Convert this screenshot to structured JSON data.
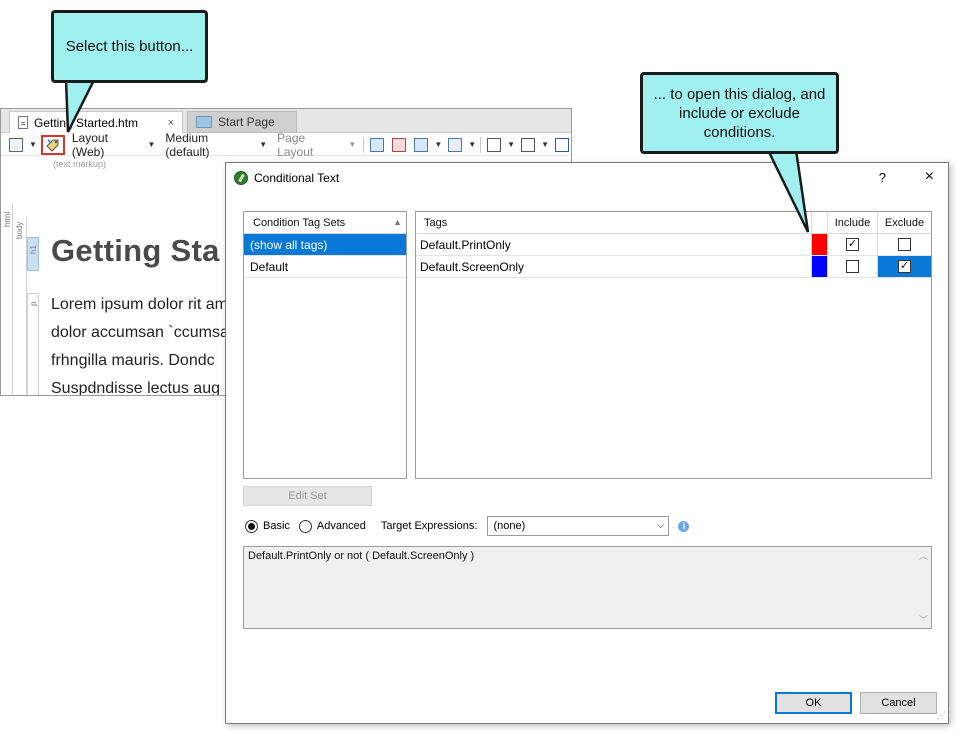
{
  "editor": {
    "tabs": [
      {
        "label": "Getting Started.htm",
        "close": "×"
      },
      {
        "label": "Start Page"
      }
    ],
    "toolbar": {
      "layout": "Layout (Web)",
      "medium": "Medium (default)",
      "page_layout": "Page Layout"
    },
    "markup_label": "(text markup)",
    "ruler_tags": {
      "html": "html",
      "body": "body",
      "h1": "h1",
      "p": "p"
    },
    "heading": "Getting Sta",
    "body_lines": [
      "Lorem ipsum dolor rit am",
      "dolor accumsan `ccumsa",
      "frhngilla mauris. Dondc",
      "Suspdndisse lectus aug"
    ]
  },
  "callouts": {
    "select_button": "Select this button...",
    "open_dialog": "... to open this dialog, and include or exclude conditions."
  },
  "dialog": {
    "title": "Conditional Text",
    "help": "?",
    "close": "×",
    "sets_header": "Condition Tag Sets",
    "sets": [
      {
        "label": "(show all tags)",
        "selected": true
      },
      {
        "label": "Default",
        "selected": false
      }
    ],
    "tags_columns": {
      "tags": "Tags",
      "include": "Include",
      "exclude": "Exclude"
    },
    "tags": [
      {
        "name": "Default.PrintOnly",
        "color": "#ff0000",
        "include": true,
        "exclude": false
      },
      {
        "name": "Default.ScreenOnly",
        "color": "#0000ff",
        "include": false,
        "exclude": true
      }
    ],
    "edit_set": "Edit Set",
    "mode": {
      "basic": "Basic",
      "advanced": "Advanced",
      "selected": "basic"
    },
    "target_label": "Target Expressions:",
    "target_value": "(none)",
    "expression": "Default.PrintOnly or not ( Default.ScreenOnly )",
    "ok": "OK",
    "cancel": "Cancel"
  },
  "colors": {
    "callout_fill": "#a0f0f0",
    "selection": "#0a78d7",
    "highlight_border": "#d9362b"
  }
}
